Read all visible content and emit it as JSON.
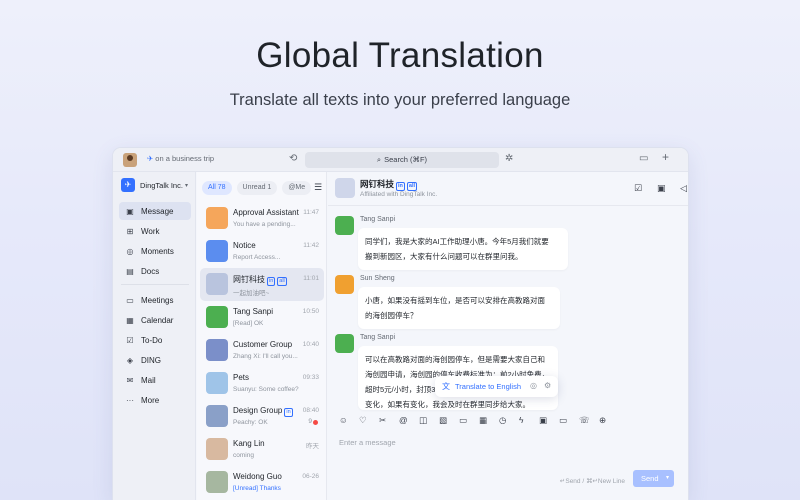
{
  "hero": {
    "title": "Global Translation",
    "subtitle": "Translate all texts into your preferred language"
  },
  "topbar": {
    "status": "on a business trip",
    "search_label": "Search (⌘F)"
  },
  "org": {
    "name": "DingTalk Inc.",
    "logo_glyph": "✈"
  },
  "nav": {
    "items": [
      {
        "label": "Message",
        "icon": "message-icon",
        "glyph": "▣"
      },
      {
        "label": "Work",
        "icon": "grid-icon",
        "glyph": "⊞"
      },
      {
        "label": "Moments",
        "icon": "moments-icon",
        "glyph": "◎"
      },
      {
        "label": "Docs",
        "icon": "doc-icon",
        "glyph": "▤"
      },
      {
        "label": "Meetings",
        "icon": "video-icon",
        "glyph": "▭"
      },
      {
        "label": "Calendar",
        "icon": "calendar-icon",
        "glyph": "▦"
      },
      {
        "label": "To-Do",
        "icon": "todo-icon",
        "glyph": "☑"
      },
      {
        "label": "DING",
        "icon": "ding-icon",
        "glyph": "◈"
      },
      {
        "label": "Mail",
        "icon": "mail-icon",
        "glyph": "✉"
      },
      {
        "label": "More",
        "icon": "more-icon",
        "glyph": "···"
      }
    ]
  },
  "filters": {
    "all": "All 78",
    "unread": "Unread 1",
    "at_me": "@Me"
  },
  "chats": [
    {
      "name": "Approval Assistant",
      "preview": "You have a pending...",
      "time": "11:47",
      "color": "#f5a65b"
    },
    {
      "name": "Notice",
      "preview": "Report Access...",
      "time": "11:42",
      "color": "#5b8def"
    },
    {
      "name": "网钉科技",
      "tags": [
        "in",
        "all"
      ],
      "preview": "一起加油吧~",
      "time": "11:01",
      "color": "#b9c4de"
    },
    {
      "name": "Tang Sanpi",
      "preview": "[Read] OK",
      "time": "10:50",
      "color": "#4caf50"
    },
    {
      "name": "Customer Group",
      "preview": "Zhang Xi: I'll call you...",
      "time": "10:40",
      "color": "#7b8fc9"
    },
    {
      "name": "Pets",
      "preview": "Suanyu: Some coffee?",
      "time": "09:33",
      "color": "#9fc4e8"
    },
    {
      "name": "Design Group",
      "tags": [
        "in"
      ],
      "preview": "Peachy: OK",
      "time": "08:40",
      "count": "9",
      "color": "#8aa0c8"
    },
    {
      "name": "Kang Lin",
      "preview": "coming",
      "time": "昨天",
      "color": "#d8b9a0"
    },
    {
      "name": "Weidong Guo",
      "preview": "[Unread] Thanks",
      "time": "06-26",
      "color": "#a6b7a0"
    }
  ],
  "conversation": {
    "title": "网钉科技",
    "title_tags": [
      "in",
      "all"
    ],
    "subtitle": "Affiliated with DingTalk Inc.",
    "messages": [
      {
        "sender": "Tang Sanpi",
        "lines": [
          "同学们，我是大家的AI工作助理小唐。今年5月我们就要",
          "搬到新园区，大家有什么问题可以在群里问我。"
        ]
      },
      {
        "sender": "Sun Sheng",
        "lines": [
          "小唐，如果没有摇到车位，是否可以安排在高教路对面",
          "的海创园停车？"
        ]
      },
      {
        "sender": "Tang Sanpi",
        "lines": [
          "可以在高教路对面的海创园停车，但是需要大家自己和",
          "海创园申请，海创园的停车收费标准为：前2小时免费，",
          "超时5元/小时，封顶30元。相关信息可能会随时调整，",
          "变化，如果有变化，我会及时在群里同步给大家。"
        ]
      }
    ],
    "translate_label": "Translate to English",
    "input_placeholder": "Enter a message",
    "hint": "↵Send / ⌘↵New Line",
    "send_label": "Send"
  }
}
